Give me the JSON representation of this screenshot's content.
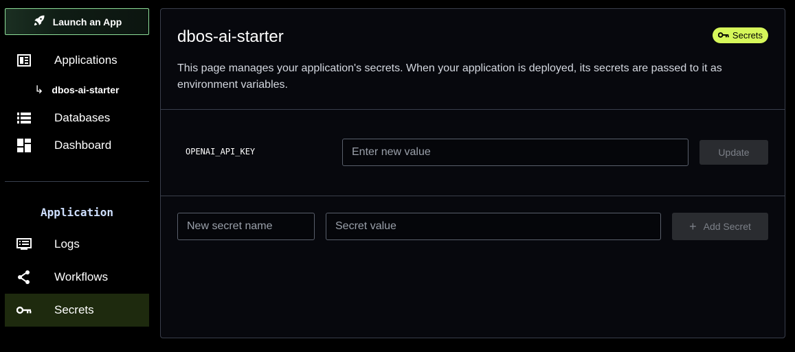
{
  "sidebar": {
    "launch_label": "Launch an App",
    "items": [
      {
        "label": "Applications",
        "icon": "applications-icon"
      },
      {
        "label": "Databases",
        "icon": "databases-icon"
      },
      {
        "label": "Dashboard",
        "icon": "dashboard-icon"
      }
    ],
    "sub_item": {
      "label": "dbos-ai-starter",
      "arrow": "↳"
    },
    "section_title": "Application",
    "app_items": [
      {
        "label": "Logs",
        "icon": "logs-icon"
      },
      {
        "label": "Workflows",
        "icon": "workflows-icon"
      },
      {
        "label": "Secrets",
        "icon": "key-icon",
        "active": true
      }
    ]
  },
  "main": {
    "title": "dbos-ai-starter",
    "badge": "Secrets",
    "description": "This page manages your application's secrets. When your application is deployed, its secrets are passed to it as environment variables.",
    "secrets": [
      {
        "name": "OPENAI_API_KEY",
        "value_placeholder": "Enter new value",
        "update_label": "Update"
      }
    ],
    "new_secret": {
      "name_placeholder": "New secret name",
      "value_placeholder": "Secret value",
      "add_label": "Add Secret",
      "add_icon": "+"
    }
  },
  "colors": {
    "accent": "#d6f75a",
    "active_bg": "#1e2a0e",
    "launch_border": "#8ee09a",
    "panel_border": "#3a3f4c"
  }
}
